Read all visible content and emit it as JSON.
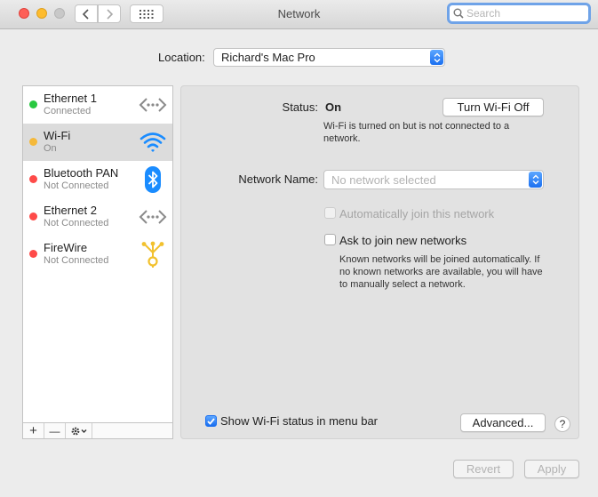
{
  "window": {
    "title": "Network",
    "search_placeholder": "Search",
    "back_icon": "chevron-left-icon",
    "forward_icon": "chevron-right-icon",
    "show_all_icon": "grid-icon"
  },
  "location": {
    "label": "Location:",
    "value": "Richard's Mac Pro"
  },
  "services": [
    {
      "name": "Ethernet 1",
      "status": "Connected",
      "dot_color": "#28c840",
      "icon": "ethernet-icon"
    },
    {
      "name": "Wi-Fi",
      "status": "On",
      "dot_color": "#f5b93a",
      "icon": "wifi-icon",
      "selected": true
    },
    {
      "name": "Bluetooth PAN",
      "status": "Not Connected",
      "dot_color": "#fe4b49",
      "icon": "bluetooth-icon"
    },
    {
      "name": "Ethernet 2",
      "status": "Not Connected",
      "dot_color": "#fe4b49",
      "icon": "ethernet-icon"
    },
    {
      "name": "FireWire",
      "status": "Not Connected",
      "dot_color": "#fe4b49",
      "icon": "firewire-icon"
    }
  ],
  "sidebar_toolbar": {
    "add": "+",
    "remove": "—",
    "action_icon": "gear-icon"
  },
  "wifi": {
    "status_label": "Status:",
    "status_value": "On",
    "toggle_button": "Turn Wi-Fi Off",
    "status_description": "Wi-Fi is turned on but is not connected to a network.",
    "network_name_label": "Network Name:",
    "network_name_placeholder": "No network selected",
    "auto_join_label": "Automatically join this network",
    "auto_join_checked": false,
    "auto_join_enabled": false,
    "ask_to_join_label": "Ask to join new networks",
    "ask_to_join_checked": false,
    "ask_to_join_description": "Known networks will be joined automatically. If no known networks are available, you will have to manually select a network.",
    "show_status_label": "Show Wi-Fi status in menu bar",
    "show_status_checked": true,
    "advanced_button": "Advanced...",
    "help_button": "?"
  },
  "footer": {
    "revert": "Revert",
    "apply": "Apply"
  },
  "colors": {
    "accent": "#1a6ff0",
    "wifi_icon": "#1a8cff",
    "bluetooth_icon": "#1a8cff",
    "firewire_icon": "#f2c12e"
  }
}
